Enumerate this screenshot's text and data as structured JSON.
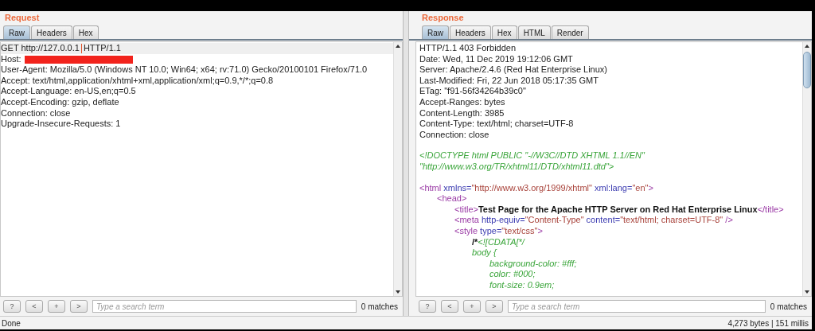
{
  "request": {
    "title": "Request",
    "tabs": [
      {
        "label": "Raw",
        "selected": true
      },
      {
        "label": "Headers",
        "selected": false
      },
      {
        "label": "Hex",
        "selected": false
      }
    ],
    "lines": [
      {
        "current": true,
        "parts": [
          {
            "kind": "text",
            "text": "GET http://127.0.0.1"
          },
          {
            "kind": "caret"
          },
          {
            "kind": "text",
            "text": "HTTP/1.1"
          }
        ]
      },
      {
        "current": false,
        "parts": [
          {
            "kind": "text",
            "text": "Host:"
          },
          {
            "kind": "redacted"
          }
        ]
      },
      {
        "current": false,
        "parts": [
          {
            "kind": "text",
            "text": "User-Agent: Mozilla/5.0 (Windows NT 10.0; Win64; x64; rv:71.0) Gecko/20100101 Firefox/71.0"
          }
        ]
      },
      {
        "current": false,
        "parts": [
          {
            "kind": "text",
            "text": "Accept: text/html,application/xhtml+xml,application/xml;q=0.9,*/*;q=0.8"
          }
        ]
      },
      {
        "current": false,
        "parts": [
          {
            "kind": "text",
            "text": "Accept-Language: en-US,en;q=0.5"
          }
        ]
      },
      {
        "current": false,
        "parts": [
          {
            "kind": "text",
            "text": "Accept-Encoding: gzip, deflate"
          }
        ]
      },
      {
        "current": false,
        "parts": [
          {
            "kind": "text",
            "text": "Connection: close"
          }
        ]
      },
      {
        "current": false,
        "parts": [
          {
            "kind": "text",
            "text": "Upgrade-Insecure-Requests: 1"
          }
        ]
      }
    ],
    "search": {
      "buttons": [
        "?",
        "<",
        "+",
        ">"
      ],
      "placeholder": "Type a search term",
      "matches": "0 matches"
    }
  },
  "response": {
    "title": "Response",
    "tabs": [
      {
        "label": "Raw",
        "selected": true
      },
      {
        "label": "Headers",
        "selected": false
      },
      {
        "label": "Hex",
        "selected": false
      },
      {
        "label": "HTML",
        "selected": false
      },
      {
        "label": "Render",
        "selected": false
      }
    ],
    "header_lines": [
      "HTTP/1.1 403 Forbidden",
      "Date: Wed, 11 Dec 2019 19:12:06 GMT",
      "Server: Apache/2.4.6 (Red Hat Enterprise Linux)",
      "Last-Modified: Fri, 22 Jun 2018 05:17:35 GMT",
      "ETag: \"f91-56f34264b39c0\"",
      "Accept-Ranges: bytes",
      "Content-Length: 3985",
      "Content-Type: text/html; charset=UTF-8",
      "Connection: close"
    ],
    "blocks": [
      [
        {
          "parts": [
            {
              "kind": "comment",
              "text": "<!DOCTYPE html PUBLIC \"-//W3C//DTD XHTML 1.1//EN\""
            }
          ]
        },
        {
          "parts": [
            {
              "kind": "comment",
              "text": "\"http://www.w3.org/TR/xhtml11/DTD/xhtml11.dtd\">"
            }
          ]
        }
      ],
      [
        {
          "parts": [
            {
              "kind": "tag",
              "text": "<html"
            },
            {
              "kind": "attr",
              "text": " xmlns="
            },
            {
              "kind": "value",
              "text": "\"http://www.w3.org/1999/xhtml\""
            },
            {
              "kind": "attr",
              "text": " xml:lang="
            },
            {
              "kind": "value",
              "text": "\"en\""
            },
            {
              "kind": "tag",
              "text": ">"
            }
          ],
          "children": [
            {
              "parts": [
                {
                  "kind": "tag",
                  "text": "<head>"
                }
              ],
              "children": [
                {
                  "parts": [
                    {
                      "kind": "tag",
                      "text": "<title>"
                    },
                    {
                      "kind": "bold",
                      "text": "Test Page for the Apache HTTP Server on Red Hat Enterprise Linux"
                    },
                    {
                      "kind": "tag",
                      "text": "</title>"
                    }
                  ]
                },
                {
                  "parts": [
                    {
                      "kind": "tag",
                      "text": "<meta"
                    },
                    {
                      "kind": "attr",
                      "text": " http-equiv="
                    },
                    {
                      "kind": "value",
                      "text": "\"Content-Type\""
                    },
                    {
                      "kind": "attr",
                      "text": " content="
                    },
                    {
                      "kind": "value",
                      "text": "\"text/html; charset=UTF-8\""
                    },
                    {
                      "kind": "tag",
                      "text": " />"
                    }
                  ]
                },
                {
                  "parts": [
                    {
                      "kind": "tag",
                      "text": "<style"
                    },
                    {
                      "kind": "attr",
                      "text": " type="
                    },
                    {
                      "kind": "value",
                      "text": "\"text/css\""
                    },
                    {
                      "kind": "tag",
                      "text": ">"
                    }
                  ],
                  "children": [
                    {
                      "parts": [
                        {
                          "kind": "bold",
                          "text": "/*"
                        },
                        {
                          "kind": "comment",
                          "text": "<![CDATA[*/"
                        }
                      ]
                    },
                    {
                      "parts": [
                        {
                          "kind": "comment",
                          "text": "body {"
                        }
                      ],
                      "children": [
                        {
                          "parts": [
                            {
                              "kind": "comment",
                              "text": "background-color: #fff;"
                            }
                          ]
                        },
                        {
                          "parts": [
                            {
                              "kind": "comment",
                              "text": "color: #000;"
                            }
                          ]
                        },
                        {
                          "parts": [
                            {
                              "kind": "comment",
                              "text": "font-size: 0.9em;"
                            }
                          ]
                        }
                      ]
                    }
                  ]
                }
              ]
            }
          ]
        }
      ]
    ],
    "search": {
      "buttons": [
        "?",
        "<",
        "+",
        ">"
      ],
      "placeholder": "Type a search term",
      "matches": "0 matches"
    }
  },
  "status_bar": {
    "left": "Done",
    "right": "4,273 bytes | 151 millis"
  }
}
